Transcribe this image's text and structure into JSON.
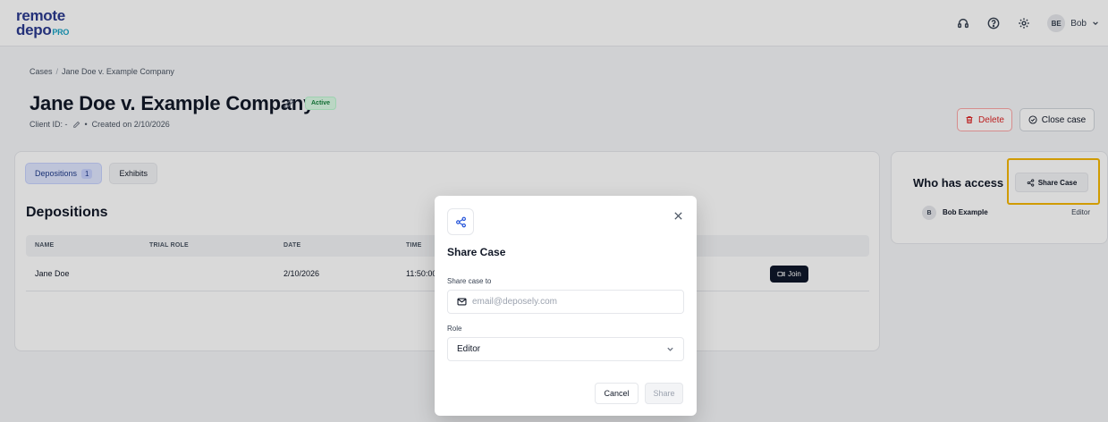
{
  "app": {
    "logo_line1": "remote",
    "logo_line2": "depo",
    "logo_pro": "PRO"
  },
  "header": {
    "icons": [
      "headset-icon",
      "help-icon",
      "settings-icon"
    ],
    "user_initials": "BE",
    "user_name": "Bob"
  },
  "breadcrumb": {
    "root": "Cases",
    "separator": "/",
    "current": "Jane Doe v. Example Company"
  },
  "case": {
    "title": "Jane Doe v. Example Company",
    "status": "Active",
    "client_id": "Client ID: -",
    "bullet": "•",
    "created": "Created on 2/10/2026"
  },
  "actions": {
    "delete_label": "Delete",
    "close_label": "Close case"
  },
  "tabs": [
    {
      "label": "Depositions",
      "count": "1",
      "active": true
    },
    {
      "label": "Exhibits",
      "active": false
    }
  ],
  "depositions": {
    "title": "Depositions",
    "columns": [
      "NAME",
      "TRIAL ROLE",
      "DATE",
      "TIME"
    ],
    "rows": [
      {
        "name": "Jane Doe",
        "trial_role": "",
        "date": "2/10/2026",
        "time": "11:50:00",
        "action": "Join"
      }
    ]
  },
  "access": {
    "title": "Who has access",
    "share_button": "Share Case",
    "members": [
      {
        "initial": "B",
        "name": "Bob Example",
        "role": "Editor"
      }
    ]
  },
  "modal": {
    "title": "Share Case",
    "share_to_label": "Share case to",
    "email_placeholder": "email@deposely.com",
    "email_value": "",
    "role_label": "Role",
    "role_value": "Editor",
    "cancel_label": "Cancel",
    "share_label": "Share"
  },
  "colors": {
    "brand": "#2b3a8f",
    "accent": "#1aa2c4",
    "status_active_bg": "#dcfce7",
    "status_active_text": "#15803d",
    "danger": "#dc2626",
    "highlight": "#f5b700",
    "join_button": "#0f172a"
  }
}
